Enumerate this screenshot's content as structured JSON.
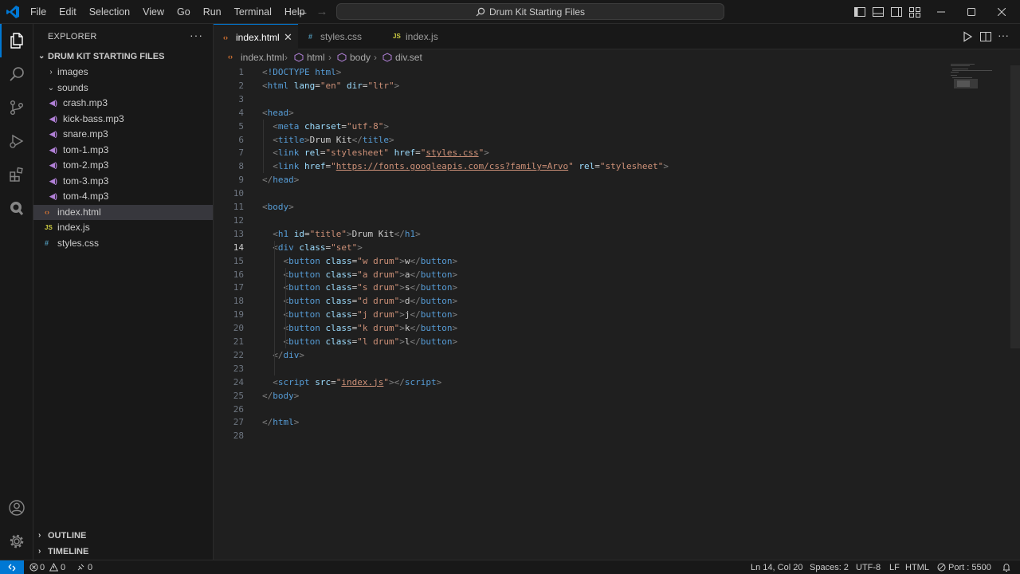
{
  "menu": [
    "File",
    "Edit",
    "Selection",
    "View",
    "Go",
    "Run",
    "Terminal",
    "Help"
  ],
  "title": {
    "search_text": "Drum Kit Starting Files"
  },
  "sidebar": {
    "title": "EXPLORER",
    "folder": "DRUM KIT STARTING FILES",
    "tree": [
      {
        "label": "images",
        "type": "folder-closed"
      },
      {
        "label": "sounds",
        "type": "folder-open"
      },
      {
        "label": "crash.mp3",
        "type": "audio"
      },
      {
        "label": "kick-bass.mp3",
        "type": "audio"
      },
      {
        "label": "snare.mp3",
        "type": "audio"
      },
      {
        "label": "tom-1.mp3",
        "type": "audio"
      },
      {
        "label": "tom-2.mp3",
        "type": "audio"
      },
      {
        "label": "tom-3.mp3",
        "type": "audio"
      },
      {
        "label": "tom-4.mp3",
        "type": "audio"
      },
      {
        "label": "index.html",
        "type": "html",
        "selected": true
      },
      {
        "label": "index.js",
        "type": "js"
      },
      {
        "label": "styles.css",
        "type": "css"
      }
    ],
    "outline": "OUTLINE",
    "timeline": "TIMELINE"
  },
  "tabs": [
    {
      "label": "index.html",
      "icon": "html",
      "active": true
    },
    {
      "label": "styles.css",
      "icon": "css",
      "active": false
    },
    {
      "label": "index.js",
      "icon": "js",
      "active": false
    }
  ],
  "icons": {
    "html": "‹›",
    "css": "#",
    "js": "JS",
    "audio": "◀)"
  },
  "breadcrumb": [
    "index.html",
    "html",
    "body",
    "div.set"
  ],
  "editor": {
    "current_line": 14,
    "lines": [
      [
        [
          "t-punct",
          "<"
        ],
        [
          "t-doc",
          "!DOCTYPE"
        ],
        [
          "",
          ""
        ],
        [
          "t-tag",
          " html"
        ],
        [
          "t-punct",
          ">"
        ]
      ],
      [
        [
          "t-punct",
          "<"
        ],
        [
          "t-tag",
          "html"
        ],
        [
          "t-attr",
          " lang"
        ],
        [
          "",
          "="
        ],
        [
          "t-str",
          "\"en\""
        ],
        [
          "t-attr",
          " dir"
        ],
        [
          "",
          "="
        ],
        [
          "t-str",
          "\"ltr\""
        ],
        [
          "t-punct",
          ">"
        ]
      ],
      [],
      [
        [
          "t-punct",
          "<"
        ],
        [
          "t-tag",
          "head"
        ],
        [
          "t-punct",
          ">"
        ]
      ],
      [
        [
          "",
          "  "
        ],
        [
          "t-punct",
          "<"
        ],
        [
          "t-tag",
          "meta"
        ],
        [
          "t-attr",
          " charset"
        ],
        [
          "",
          "="
        ],
        [
          "t-str",
          "\"utf-8\""
        ],
        [
          "t-punct",
          ">"
        ]
      ],
      [
        [
          "",
          "  "
        ],
        [
          "t-punct",
          "<"
        ],
        [
          "t-tag",
          "title"
        ],
        [
          "t-punct",
          ">"
        ],
        [
          "",
          "Drum Kit"
        ],
        [
          "t-punct",
          "</"
        ],
        [
          "t-tag",
          "title"
        ],
        [
          "t-punct",
          ">"
        ]
      ],
      [
        [
          "",
          "  "
        ],
        [
          "t-punct",
          "<"
        ],
        [
          "t-tag",
          "link"
        ],
        [
          "t-attr",
          " rel"
        ],
        [
          "",
          "="
        ],
        [
          "t-str",
          "\"stylesheet\""
        ],
        [
          "t-attr",
          " href"
        ],
        [
          "",
          "="
        ],
        [
          "t-str",
          "\""
        ],
        [
          "t-link",
          "styles.css"
        ],
        [
          "t-str",
          "\""
        ],
        [
          "t-punct",
          ">"
        ]
      ],
      [
        [
          "",
          "  "
        ],
        [
          "t-punct",
          "<"
        ],
        [
          "t-tag",
          "link"
        ],
        [
          "t-attr",
          " href"
        ],
        [
          "",
          "="
        ],
        [
          "t-str",
          "\""
        ],
        [
          "t-link",
          "https://fonts.googleapis.com/css?family=Arvo"
        ],
        [
          "t-str",
          "\""
        ],
        [
          "t-attr",
          " rel"
        ],
        [
          "",
          "="
        ],
        [
          "t-str",
          "\"stylesheet\""
        ],
        [
          "t-punct",
          ">"
        ]
      ],
      [
        [
          "t-punct",
          "</"
        ],
        [
          "t-tag",
          "head"
        ],
        [
          "t-punct",
          ">"
        ]
      ],
      [],
      [
        [
          "t-punct",
          "<"
        ],
        [
          "t-tag",
          "body"
        ],
        [
          "t-punct",
          ">"
        ]
      ],
      [],
      [
        [
          "",
          "  "
        ],
        [
          "t-punct",
          "<"
        ],
        [
          "t-tag",
          "h1"
        ],
        [
          "t-attr",
          " id"
        ],
        [
          "",
          "="
        ],
        [
          "t-str",
          "\"title\""
        ],
        [
          "t-punct",
          ">"
        ],
        [
          "",
          "Drum Kit"
        ],
        [
          "t-punct",
          "</"
        ],
        [
          "t-tag",
          "h1"
        ],
        [
          "t-punct",
          ">"
        ]
      ],
      [
        [
          "",
          "  "
        ],
        [
          "t-punct",
          "<"
        ],
        [
          "t-tag",
          "div"
        ],
        [
          "t-attr",
          " class"
        ],
        [
          "",
          "="
        ],
        [
          "t-str",
          "\"set\""
        ],
        [
          "t-punct",
          ">"
        ]
      ],
      [
        [
          "",
          "    "
        ],
        [
          "t-punct",
          "<"
        ],
        [
          "t-tag",
          "button"
        ],
        [
          "t-attr",
          " class"
        ],
        [
          "",
          "="
        ],
        [
          "t-str",
          "\"w drum\""
        ],
        [
          "t-punct",
          ">"
        ],
        [
          "",
          "w"
        ],
        [
          "t-punct",
          "</"
        ],
        [
          "t-tag",
          "button"
        ],
        [
          "t-punct",
          ">"
        ]
      ],
      [
        [
          "",
          "    "
        ],
        [
          "t-punct",
          "<"
        ],
        [
          "t-tag",
          "button"
        ],
        [
          "t-attr",
          " class"
        ],
        [
          "",
          "="
        ],
        [
          "t-str",
          "\"a drum\""
        ],
        [
          "t-punct",
          ">"
        ],
        [
          "",
          "a"
        ],
        [
          "t-punct",
          "</"
        ],
        [
          "t-tag",
          "button"
        ],
        [
          "t-punct",
          ">"
        ]
      ],
      [
        [
          "",
          "    "
        ],
        [
          "t-punct",
          "<"
        ],
        [
          "t-tag",
          "button"
        ],
        [
          "t-attr",
          " class"
        ],
        [
          "",
          "="
        ],
        [
          "t-str",
          "\"s drum\""
        ],
        [
          "t-punct",
          ">"
        ],
        [
          "",
          "s"
        ],
        [
          "t-punct",
          "</"
        ],
        [
          "t-tag",
          "button"
        ],
        [
          "t-punct",
          ">"
        ]
      ],
      [
        [
          "",
          "    "
        ],
        [
          "t-punct",
          "<"
        ],
        [
          "t-tag",
          "button"
        ],
        [
          "t-attr",
          " class"
        ],
        [
          "",
          "="
        ],
        [
          "t-str",
          "\"d drum\""
        ],
        [
          "t-punct",
          ">"
        ],
        [
          "",
          "d"
        ],
        [
          "t-punct",
          "</"
        ],
        [
          "t-tag",
          "button"
        ],
        [
          "t-punct",
          ">"
        ]
      ],
      [
        [
          "",
          "    "
        ],
        [
          "t-punct",
          "<"
        ],
        [
          "t-tag",
          "button"
        ],
        [
          "t-attr",
          " class"
        ],
        [
          "",
          "="
        ],
        [
          "t-str",
          "\"j drum\""
        ],
        [
          "t-punct",
          ">"
        ],
        [
          "",
          "j"
        ],
        [
          "t-punct",
          "</"
        ],
        [
          "t-tag",
          "button"
        ],
        [
          "t-punct",
          ">"
        ]
      ],
      [
        [
          "",
          "    "
        ],
        [
          "t-punct",
          "<"
        ],
        [
          "t-tag",
          "button"
        ],
        [
          "t-attr",
          " class"
        ],
        [
          "",
          "="
        ],
        [
          "t-str",
          "\"k drum\""
        ],
        [
          "t-punct",
          ">"
        ],
        [
          "",
          "k"
        ],
        [
          "t-punct",
          "</"
        ],
        [
          "t-tag",
          "button"
        ],
        [
          "t-punct",
          ">"
        ]
      ],
      [
        [
          "",
          "    "
        ],
        [
          "t-punct",
          "<"
        ],
        [
          "t-tag",
          "button"
        ],
        [
          "t-attr",
          " class"
        ],
        [
          "",
          "="
        ],
        [
          "t-str",
          "\"l drum\""
        ],
        [
          "t-punct",
          ">"
        ],
        [
          "",
          "l"
        ],
        [
          "t-punct",
          "</"
        ],
        [
          "t-tag",
          "button"
        ],
        [
          "t-punct",
          ">"
        ]
      ],
      [
        [
          "",
          "  "
        ],
        [
          "t-punct",
          "</"
        ],
        [
          "t-tag",
          "div"
        ],
        [
          "t-punct",
          ">"
        ]
      ],
      [],
      [
        [
          "",
          "  "
        ],
        [
          "t-punct",
          "<"
        ],
        [
          "t-tag",
          "script"
        ],
        [
          "t-attr",
          " src"
        ],
        [
          "",
          "="
        ],
        [
          "t-str",
          "\""
        ],
        [
          "t-link",
          "index.js"
        ],
        [
          "t-str",
          "\""
        ],
        [
          "t-punct",
          "></"
        ],
        [
          "t-tag",
          "script"
        ],
        [
          "t-punct",
          ">"
        ]
      ],
      [
        [
          "t-punct",
          "</"
        ],
        [
          "t-tag",
          "body"
        ],
        [
          "t-punct",
          ">"
        ]
      ],
      [],
      [
        [
          "t-punct",
          "</"
        ],
        [
          "t-tag",
          "html"
        ],
        [
          "t-punct",
          ">"
        ]
      ],
      []
    ]
  },
  "status": {
    "errors": "0",
    "warnings": "0",
    "ports": "0",
    "position": "Ln 14, Col 20",
    "spaces": "Spaces: 2",
    "encoding": "UTF-8",
    "eol": "LF",
    "language": "HTML",
    "port": "Port : 5500"
  },
  "colors": {
    "accent": "#0078d4",
    "background": "#1f1f1f",
    "sidebar": "#181818"
  }
}
